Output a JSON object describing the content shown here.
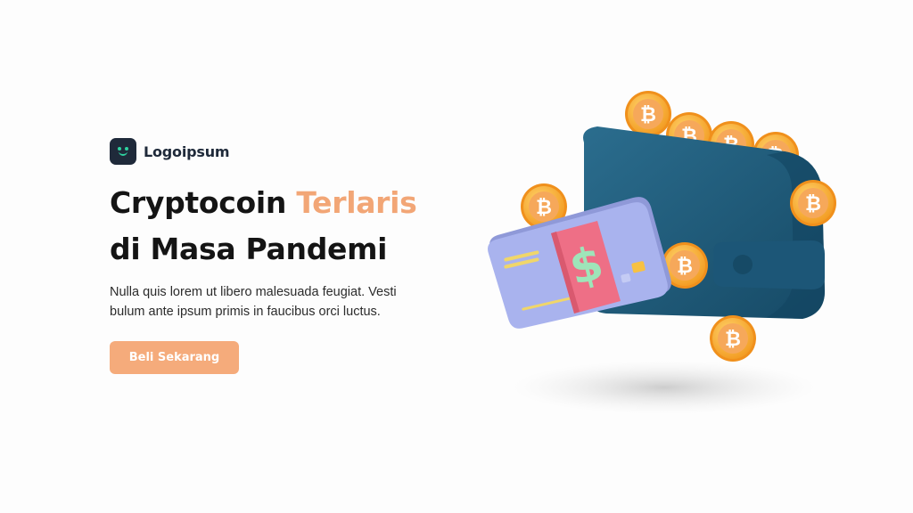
{
  "brand": {
    "name": "Logoipsum",
    "logo_icon": "smiley-face-icon",
    "logo_color": "#1f2a3a",
    "logo_accent": "#2ed3a0"
  },
  "hero": {
    "headline_part1": "Cryptocoin ",
    "headline_accent": "Terlaris",
    "headline_line2": "di Masa Pandemi",
    "description": "Nulla quis lorem ut libero malesuada feugiat. Vesti bulum ante ipsum primis in faucibus orci luctus.",
    "cta_label": "Beli Sekarang",
    "accent_color": "#f2a676"
  },
  "illustration": {
    "wallet_icon": "wallet-icon",
    "card_icon": "credit-card-icon",
    "cash_icon": "dollar-cash-icon",
    "coin_icon": "bitcoin-icon",
    "cash_symbol": "$",
    "coin_symbol": "₿",
    "wallet_color": "#1f5a78",
    "card_color": "#a9b3ee",
    "cash_band_color": "#ee6f86",
    "cash_symbol_color": "#9ee5b9",
    "coin_color": "#f7a63a"
  }
}
